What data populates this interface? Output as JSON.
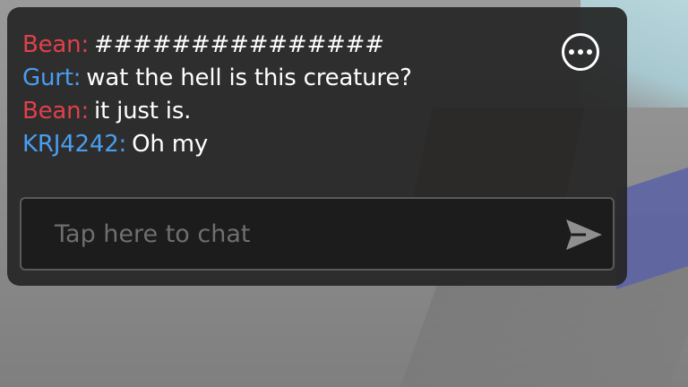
{
  "chat": {
    "messages": [
      {
        "sender": "Bean:",
        "text": "###############",
        "sender_color": "#e0404a"
      },
      {
        "sender": "Gurt:",
        "text": "wat the hell is this creature?",
        "sender_color": "#4a9ef0"
      },
      {
        "sender": "Bean:",
        "text": "it just is.",
        "sender_color": "#e0404a"
      },
      {
        "sender": "KRJ4242:",
        "text": "Oh my",
        "sender_color": "#4a9ef0"
      }
    ],
    "input": {
      "placeholder": "Tap here to chat",
      "value": ""
    },
    "options_icon": "more-horizontal-circle-icon",
    "send_icon": "send-arrow-icon"
  },
  "colors": {
    "panel_background": "#262626",
    "input_background": "#1c1c1c",
    "placeholder": "#6f6f6f",
    "text": "#ffffff"
  }
}
